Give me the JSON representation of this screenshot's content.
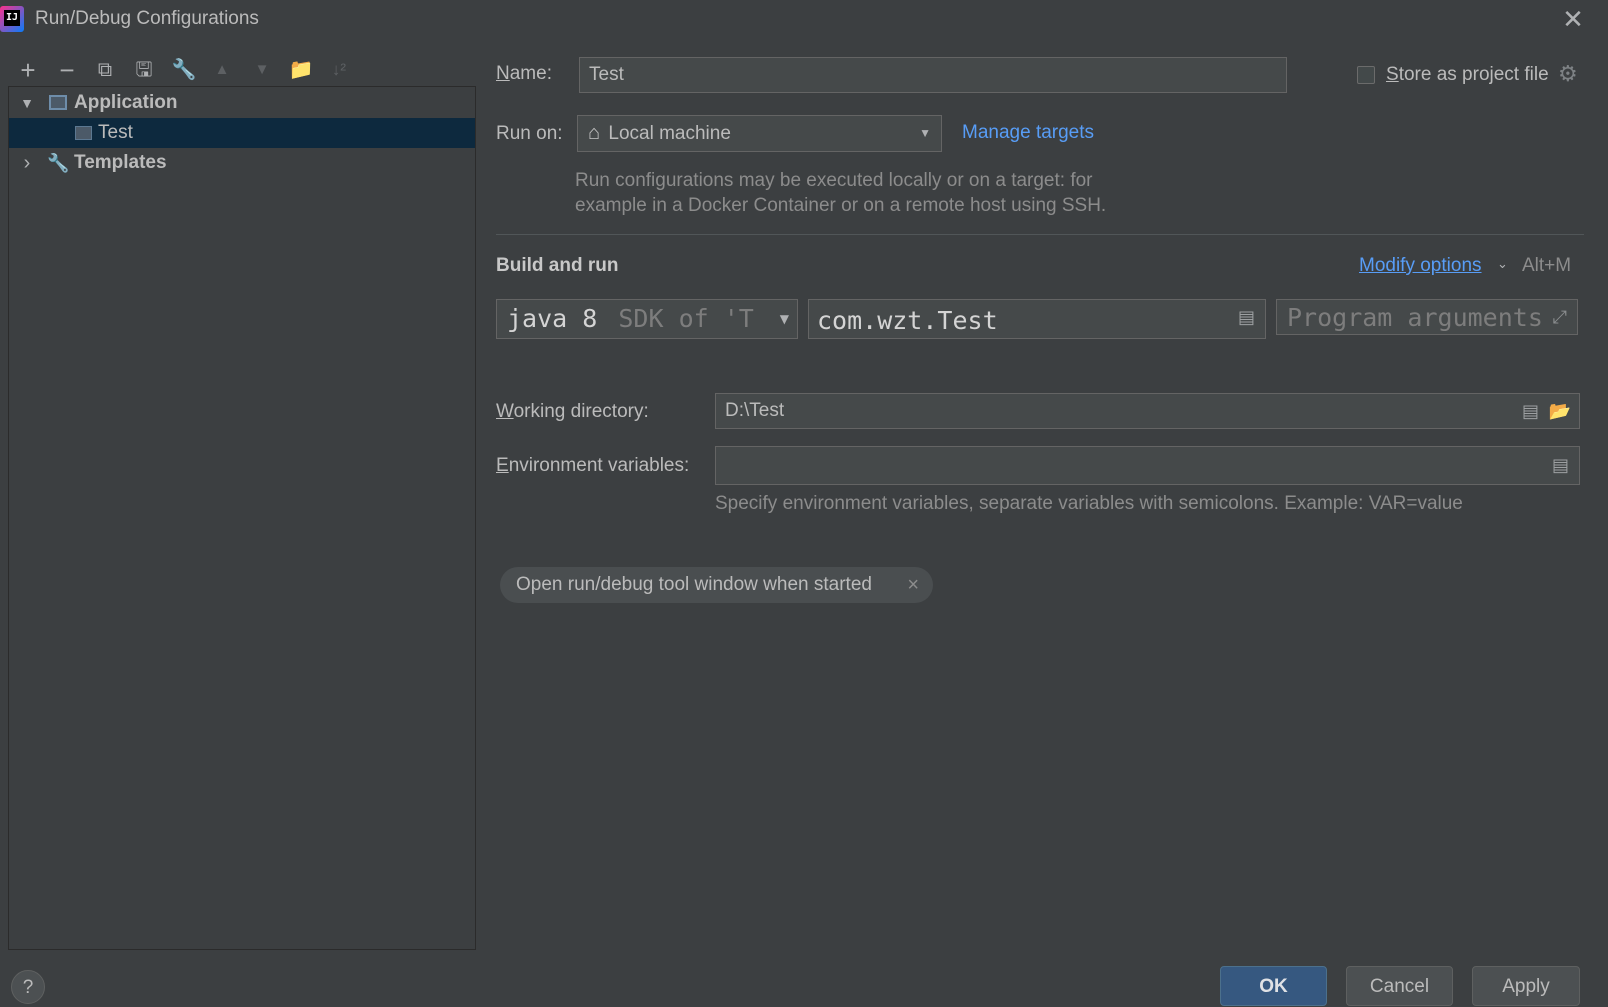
{
  "window": {
    "title": "Run/Debug Configurations",
    "logo_text": "IJ",
    "close_glyph": "✕"
  },
  "toolbar": {
    "add": "+",
    "remove": "−",
    "copy": "⧉",
    "save": "🖫",
    "edit_templates": "🔧",
    "move_up": "▲",
    "move_down": "▼",
    "new_folder": "📁",
    "sort": "↓²"
  },
  "tree": {
    "application": {
      "label": "Application",
      "arrow": "▼"
    },
    "test": {
      "label": "Test"
    },
    "templates": {
      "label": "Templates",
      "arrow": "›",
      "icon": "🔧"
    }
  },
  "config": {
    "name_label_u": "N",
    "name_label_rest": "ame:",
    "name_value": "Test",
    "store_label_u": "S",
    "store_label_rest": "tore as project file",
    "store_checked": false,
    "run_on_label": "Run on:",
    "run_on_value": "Local machine",
    "run_on_icon": "⌂",
    "manage_targets": "Manage targets",
    "run_on_hint_1": "Run configurations may be executed locally or on a target: for",
    "run_on_hint_2": "example in a Docker Container or on a remote host using SSH.",
    "section_title": "Build and run",
    "modify_options": "Modify options",
    "modify_shortcut": "Alt+M",
    "jdk_value": "java 8",
    "jdk_hint": "SDK of 'T",
    "main_class": "com.wzt.Test",
    "program_args_placeholder": "Program arguments",
    "working_dir_label_u": "W",
    "working_dir_label_rest": "orking directory:",
    "working_dir_value": "D:\\Test",
    "env_label_u": "E",
    "env_label_rest": "nvironment variables:",
    "env_value": "",
    "env_hint": "Specify environment variables, separate variables with semicolons. Example: VAR=value",
    "chip_label": "Open run/debug tool window when started",
    "chip_close": "×"
  },
  "footer": {
    "help": "?",
    "ok": "OK",
    "cancel": "Cancel",
    "apply": "Apply"
  },
  "colors": {
    "background": "#3c3f41",
    "selection": "#0d293e",
    "link": "#589df6",
    "default_button": "#365880"
  }
}
